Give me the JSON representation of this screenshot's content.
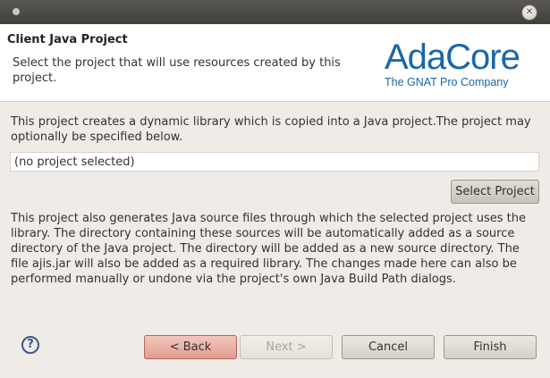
{
  "header": {
    "title": "Client Java Project",
    "description": "Select the project that will use resources created by this project.",
    "logo_main": "AdaCore",
    "logo_sub": "The GNAT Pro Company"
  },
  "body": {
    "intro_text": "This project creates a dynamic library which is copied into a Java project.The project may optionally be specified below.",
    "project_field_value": "(no project selected)",
    "select_project_label": "Select Project",
    "detail_text": "This project also generates Java source files through which the selected project uses the library. The directory containing these sources will be automatically added as a source directory of the Java project. The directory will be added as a new source directory. The file ajis.jar will also be added as a required library. The changes made here can also be performed manually or undone via the project's own Java Build Path dialogs."
  },
  "footer": {
    "help_glyph": "?",
    "back_label": "< Back",
    "next_label": "Next >",
    "cancel_label": "Cancel",
    "finish_label": "Finish"
  },
  "titlebar": {
    "close_glyph": "✕"
  },
  "icons": [
    "window-menu-icon",
    "close-icon",
    "help-icon"
  ],
  "colors": {
    "brand": "#1a67a8",
    "back_button": "#e29d90"
  }
}
